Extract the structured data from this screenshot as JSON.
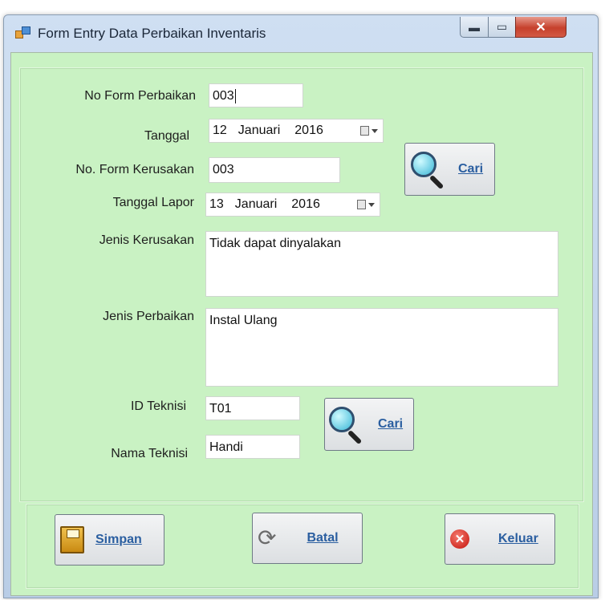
{
  "window": {
    "title": "Form Entry Data Perbaikan Inventaris",
    "controls": {
      "minimize": "▬",
      "maximize": "▭",
      "close": "✕"
    }
  },
  "form": {
    "no_form_perbaikan": {
      "label": "No Form Perbaikan",
      "value": "003"
    },
    "tanggal": {
      "label": "Tanggal",
      "day": "12",
      "month": "Januari",
      "year": "2016"
    },
    "no_form_kerusakan": {
      "label": "No. Form Kerusakan",
      "value": "003"
    },
    "tanggal_lapor": {
      "label": "Tanggal Lapor",
      "day": "13",
      "month": "Januari",
      "year": "2016"
    },
    "jenis_kerusakan": {
      "label": "Jenis Kerusakan",
      "value": "Tidak dapat dinyalakan"
    },
    "jenis_perbaikan": {
      "label": "Jenis Perbaikan",
      "value": "Instal Ulang"
    },
    "id_teknisi": {
      "label": "ID Teknisi",
      "value": "T01"
    },
    "nama_teknisi": {
      "label": "Nama Teknisi",
      "value": "Handi"
    },
    "cari_kerusakan_label": "Cari",
    "cari_teknisi_label": "Cari"
  },
  "actions": {
    "simpan": "Simpan",
    "batal": "Batal",
    "keluar": "Keluar"
  },
  "icons": {
    "app": "app-window-icon",
    "search": "magnifier-icon",
    "save": "floppy-disk-icon",
    "refresh": "refresh-icon",
    "exit": "red-x-icon"
  },
  "colors": {
    "form_background": "#c9f2c3",
    "button_text": "#2a5ea0",
    "close_button": "#c6402c"
  }
}
